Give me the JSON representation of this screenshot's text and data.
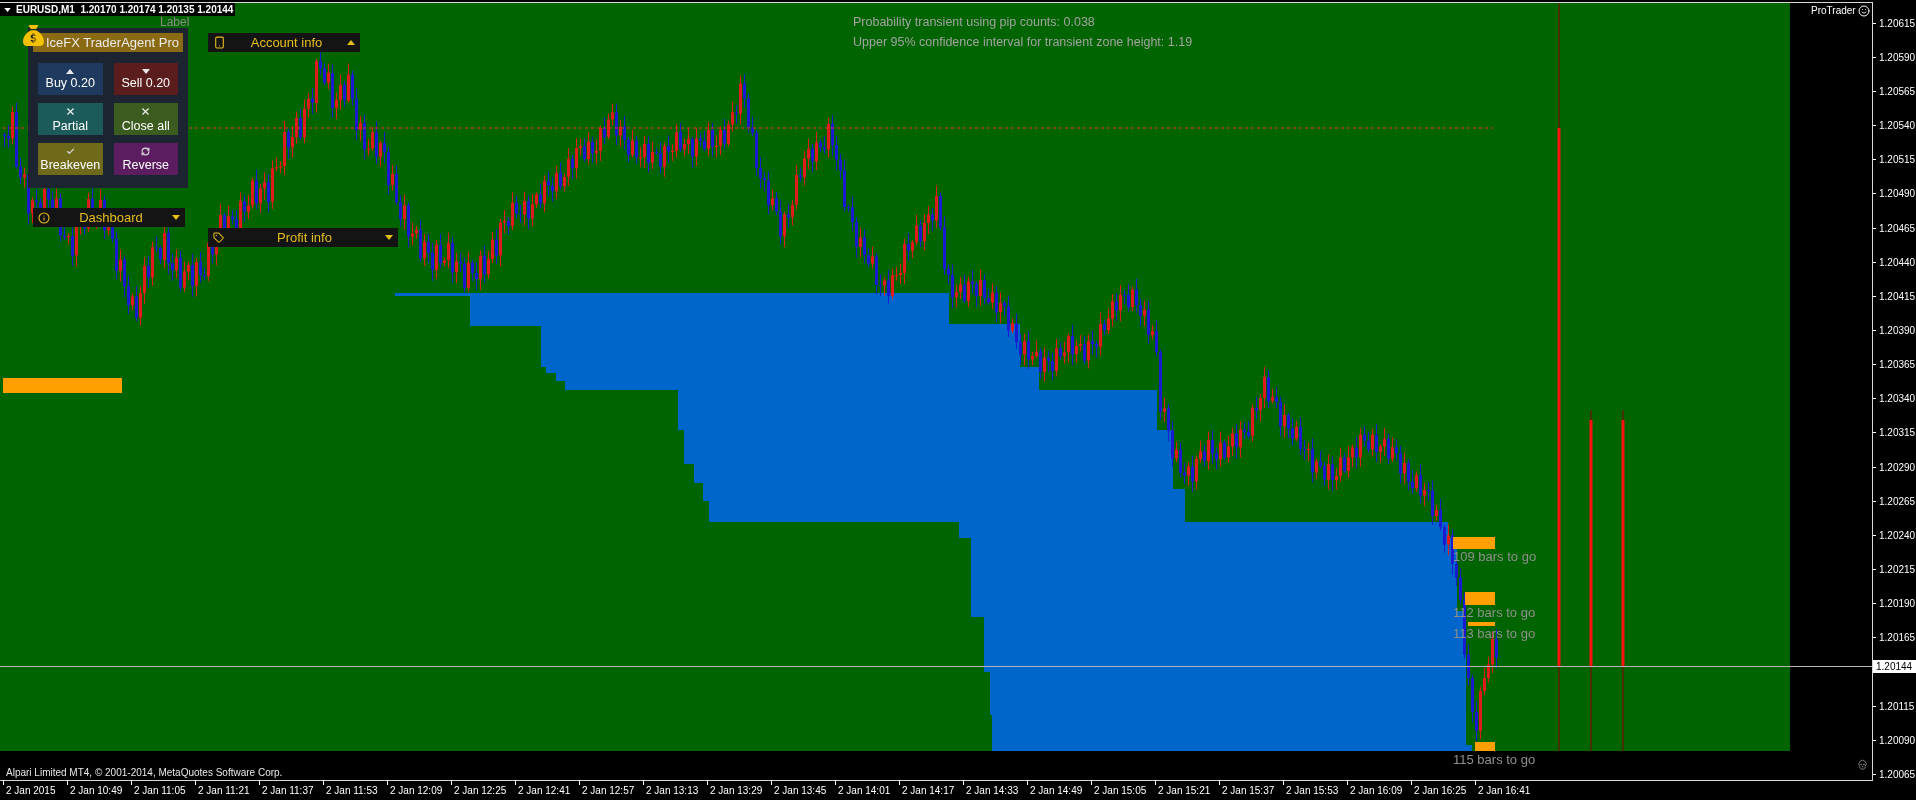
{
  "chart_header": {
    "symbol_quotes": "EURUSD,M1  1.20170 1.20174 1.20135 1.20144"
  },
  "chart_label": "Label",
  "trade_panel": {
    "title": "IceFX TraderAgent Pro",
    "buttons": [
      {
        "label": "Buy 0.20",
        "kind": "up",
        "color": "#1e3a5f"
      },
      {
        "label": "Sell 0.20",
        "kind": "down",
        "color": "#5a1c1c"
      },
      {
        "label": "Partial",
        "kind": "close",
        "color": "#1d5b5b"
      },
      {
        "label": "Close all",
        "kind": "close",
        "color": "#3b5b1f"
      },
      {
        "label": "Breakeven",
        "kind": "check",
        "color": "#6e6a1a"
      },
      {
        "label": "Reverse",
        "kind": "reverse",
        "color": "#5b1d5f"
      }
    ]
  },
  "info_bars": [
    {
      "label": "Account info",
      "kind": "account",
      "expanded": true
    },
    {
      "label": "Dashboard",
      "kind": "dashboard",
      "expanded": false
    },
    {
      "label": "Profit info",
      "kind": "profit",
      "expanded": false
    }
  ],
  "statistics": [
    "Probability transient using pip counts: 0.038",
    "Upper 95% confidence interval for transient zone height: 1.19"
  ],
  "bar_countdowns": [
    "109 bars to go",
    "112 bars to go",
    "113 bars to go",
    "115 bars to go"
  ],
  "indicator_badge": "ProTrader",
  "copyright": "Alpari Limited MT4, © 2001-2014, MetaQuotes Software Corp.",
  "price_axis": [
    {
      "text": "1.20615",
      "kind": "tick"
    },
    {
      "text": "1.20590",
      "kind": "tick"
    },
    {
      "text": "1.20565",
      "kind": "tick"
    },
    {
      "text": "1.20540",
      "kind": "tick"
    },
    {
      "text": "1.20515",
      "kind": "tick"
    },
    {
      "text": "1.20490",
      "kind": "tick"
    },
    {
      "text": "1.20465",
      "kind": "tick"
    },
    {
      "text": "1.20440",
      "kind": "tick"
    },
    {
      "text": "1.20415",
      "kind": "tick"
    },
    {
      "text": "1.20390",
      "kind": "tick"
    },
    {
      "text": "1.20365",
      "kind": "tick"
    },
    {
      "text": "1.20340",
      "kind": "tick"
    },
    {
      "text": "1.20315",
      "kind": "tick"
    },
    {
      "text": "1.20290",
      "kind": "tick"
    },
    {
      "text": "1.20265",
      "kind": "tick"
    },
    {
      "text": "1.20240",
      "kind": "tick"
    },
    {
      "text": "1.20215",
      "kind": "tick"
    },
    {
      "text": "1.20190",
      "kind": "tick"
    },
    {
      "text": "1.20165",
      "kind": "tick"
    },
    {
      "text": "1.20144",
      "kind": "current"
    },
    {
      "text": "1.20115",
      "kind": "tick"
    },
    {
      "text": "1.20090",
      "kind": "tick"
    },
    {
      "text": "1.20065",
      "kind": "tick"
    }
  ],
  "time_axis": [
    "2 Jan 2015",
    "2 Jan 10:49",
    "2 Jan 11:05",
    "2 Jan 11:21",
    "2 Jan 11:37",
    "2 Jan 11:53",
    "2 Jan 12:09",
    "2 Jan 12:25",
    "2 Jan 12:41",
    "2 Jan 12:57",
    "2 Jan 13:13",
    "2 Jan 13:29",
    "2 Jan 13:45",
    "2 Jan 14:01",
    "2 Jan 14:17",
    "2 Jan 14:33",
    "2 Jan 14:49",
    "2 Jan 15:05",
    "2 Jan 15:21",
    "2 Jan 15:37",
    "2 Jan 15:53",
    "2 Jan 16:09",
    "2 Jan 16:25",
    "2 Jan 16:41"
  ]
}
